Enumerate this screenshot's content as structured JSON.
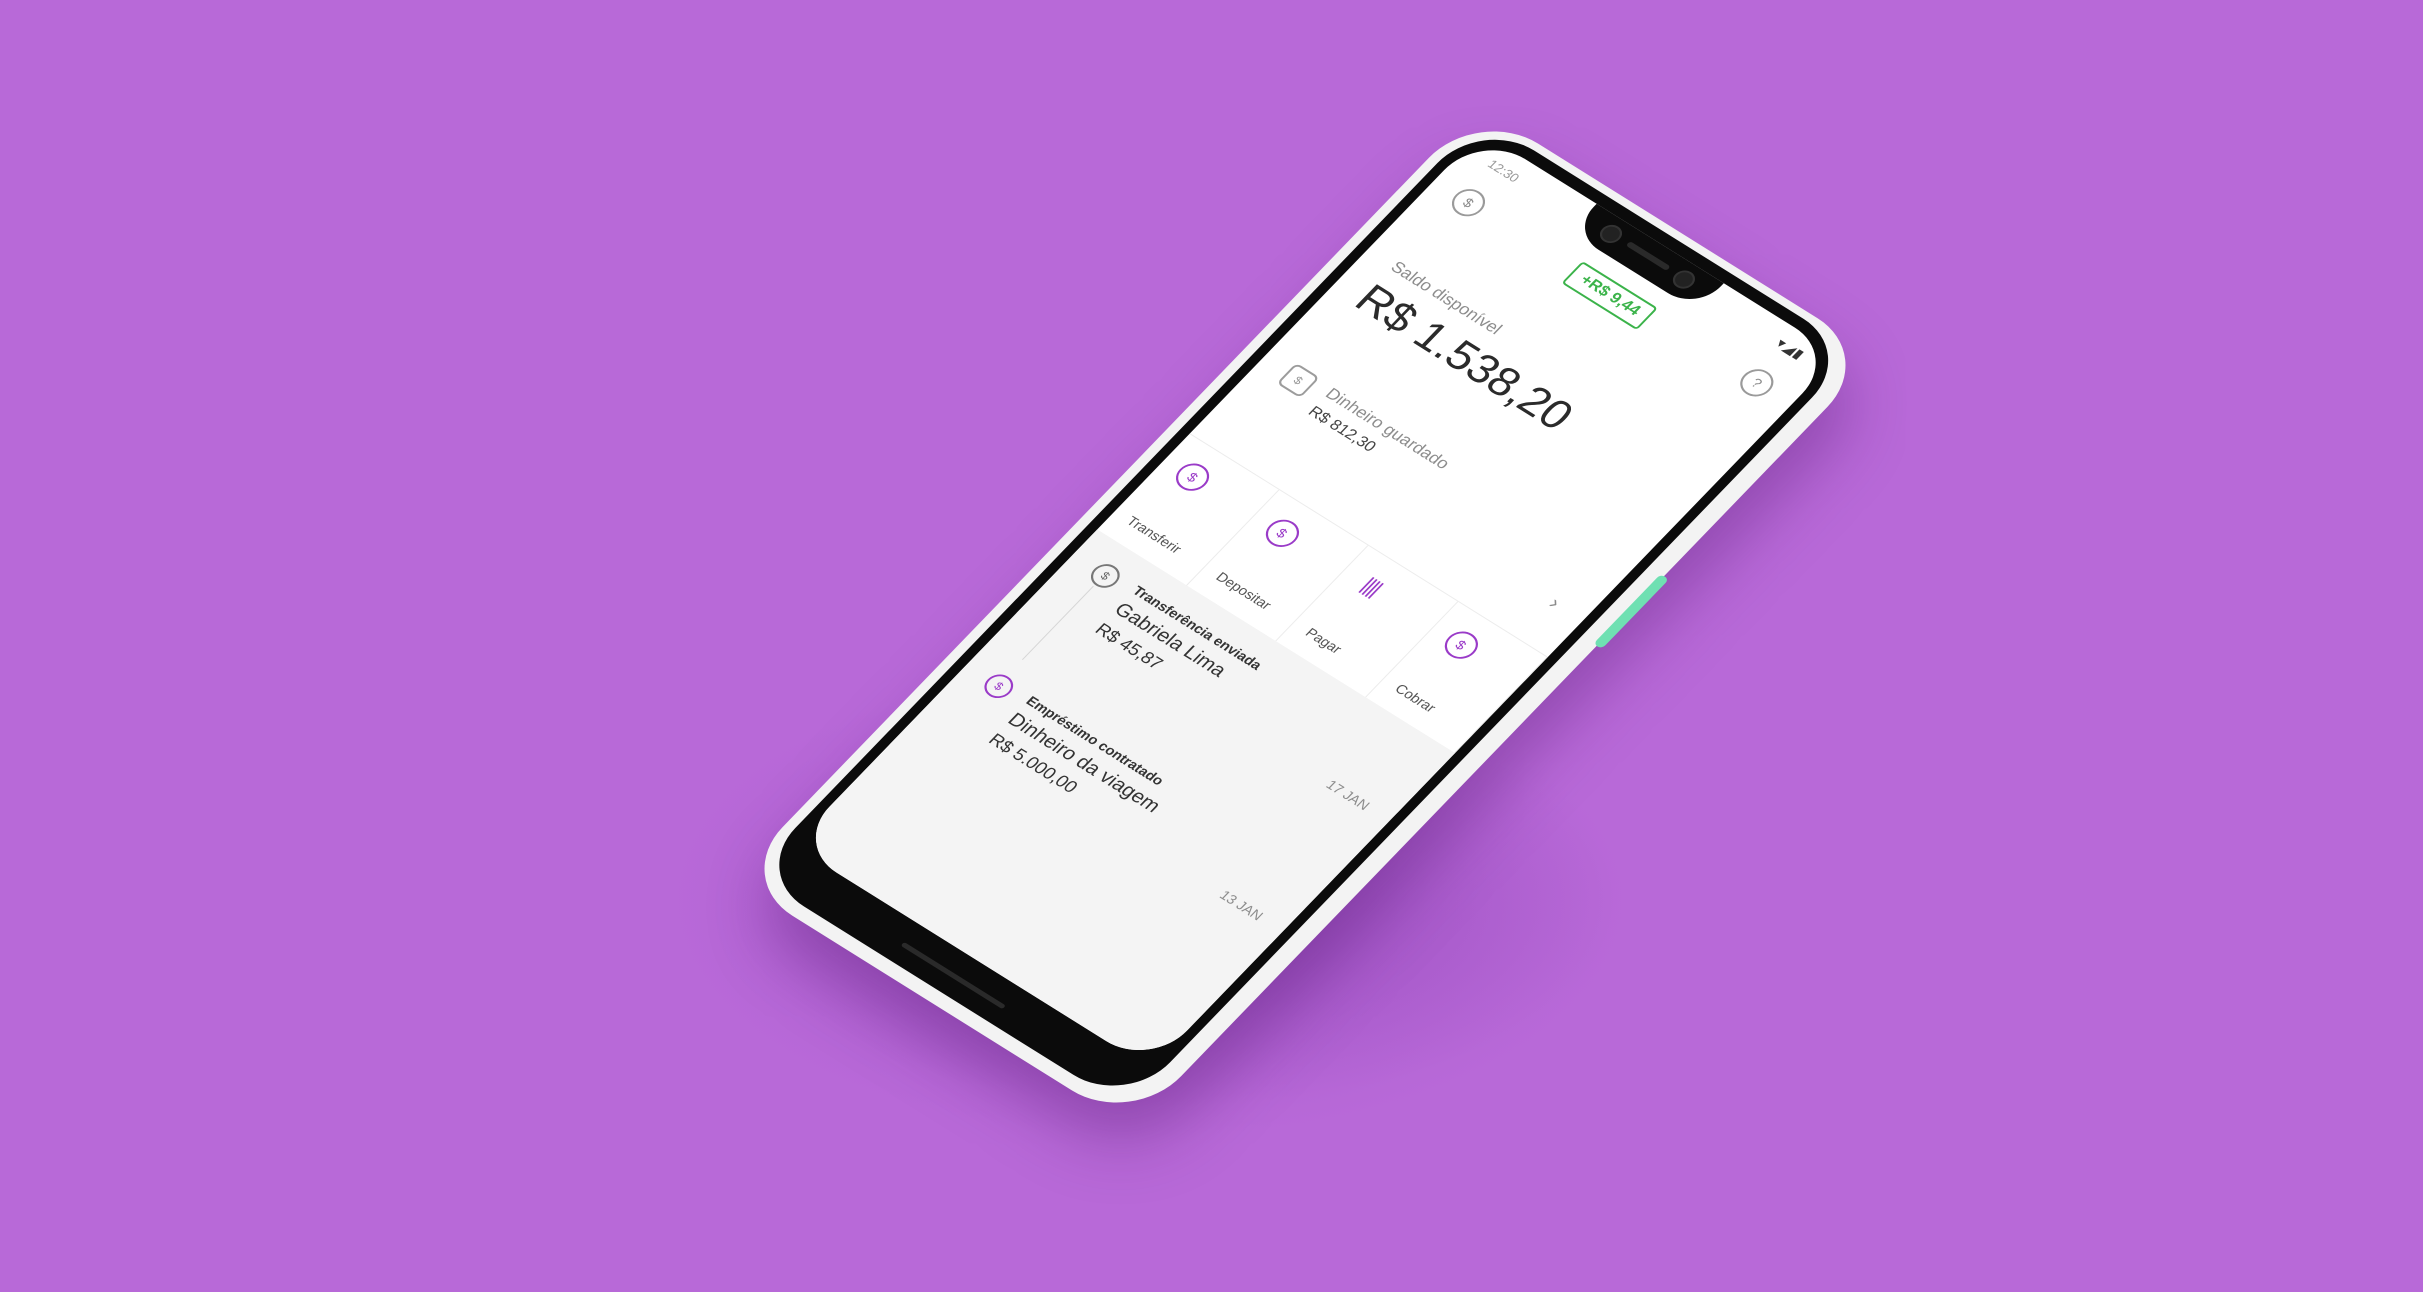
{
  "background_color": "#b869d8",
  "status_bar": {
    "time": "12:30"
  },
  "top_bar": {
    "earnings_badge": "+R$ 9,44",
    "profile_icon": "piggy-bank-icon",
    "help_icon": "question-mark-icon"
  },
  "balance": {
    "label": "Saldo disponível",
    "value": "R$ 1.538,20"
  },
  "saved_money": {
    "label": "Dinheiro guardado",
    "value": "R$ 812,30"
  },
  "actions": [
    {
      "label": "Transferir",
      "icon": "transfer-icon"
    },
    {
      "label": "Depositar",
      "icon": "deposit-icon"
    },
    {
      "label": "Pagar",
      "icon": "barcode-icon"
    },
    {
      "label": "Cobrar",
      "icon": "charge-icon"
    }
  ],
  "feed": [
    {
      "type": "Transferência enviada",
      "title": "Gabriela Lima",
      "amount": "R$ 45,87",
      "date": "17 JAN"
    },
    {
      "type": "Empréstimo contratado",
      "title": "Dinheiro da viagem",
      "amount": "R$ 5.000,00",
      "date": "13 JAN"
    }
  ],
  "colors": {
    "accent_purple": "#9a3bc8",
    "positive_green": "#3bb34a",
    "side_button": "#6fe0b2"
  }
}
